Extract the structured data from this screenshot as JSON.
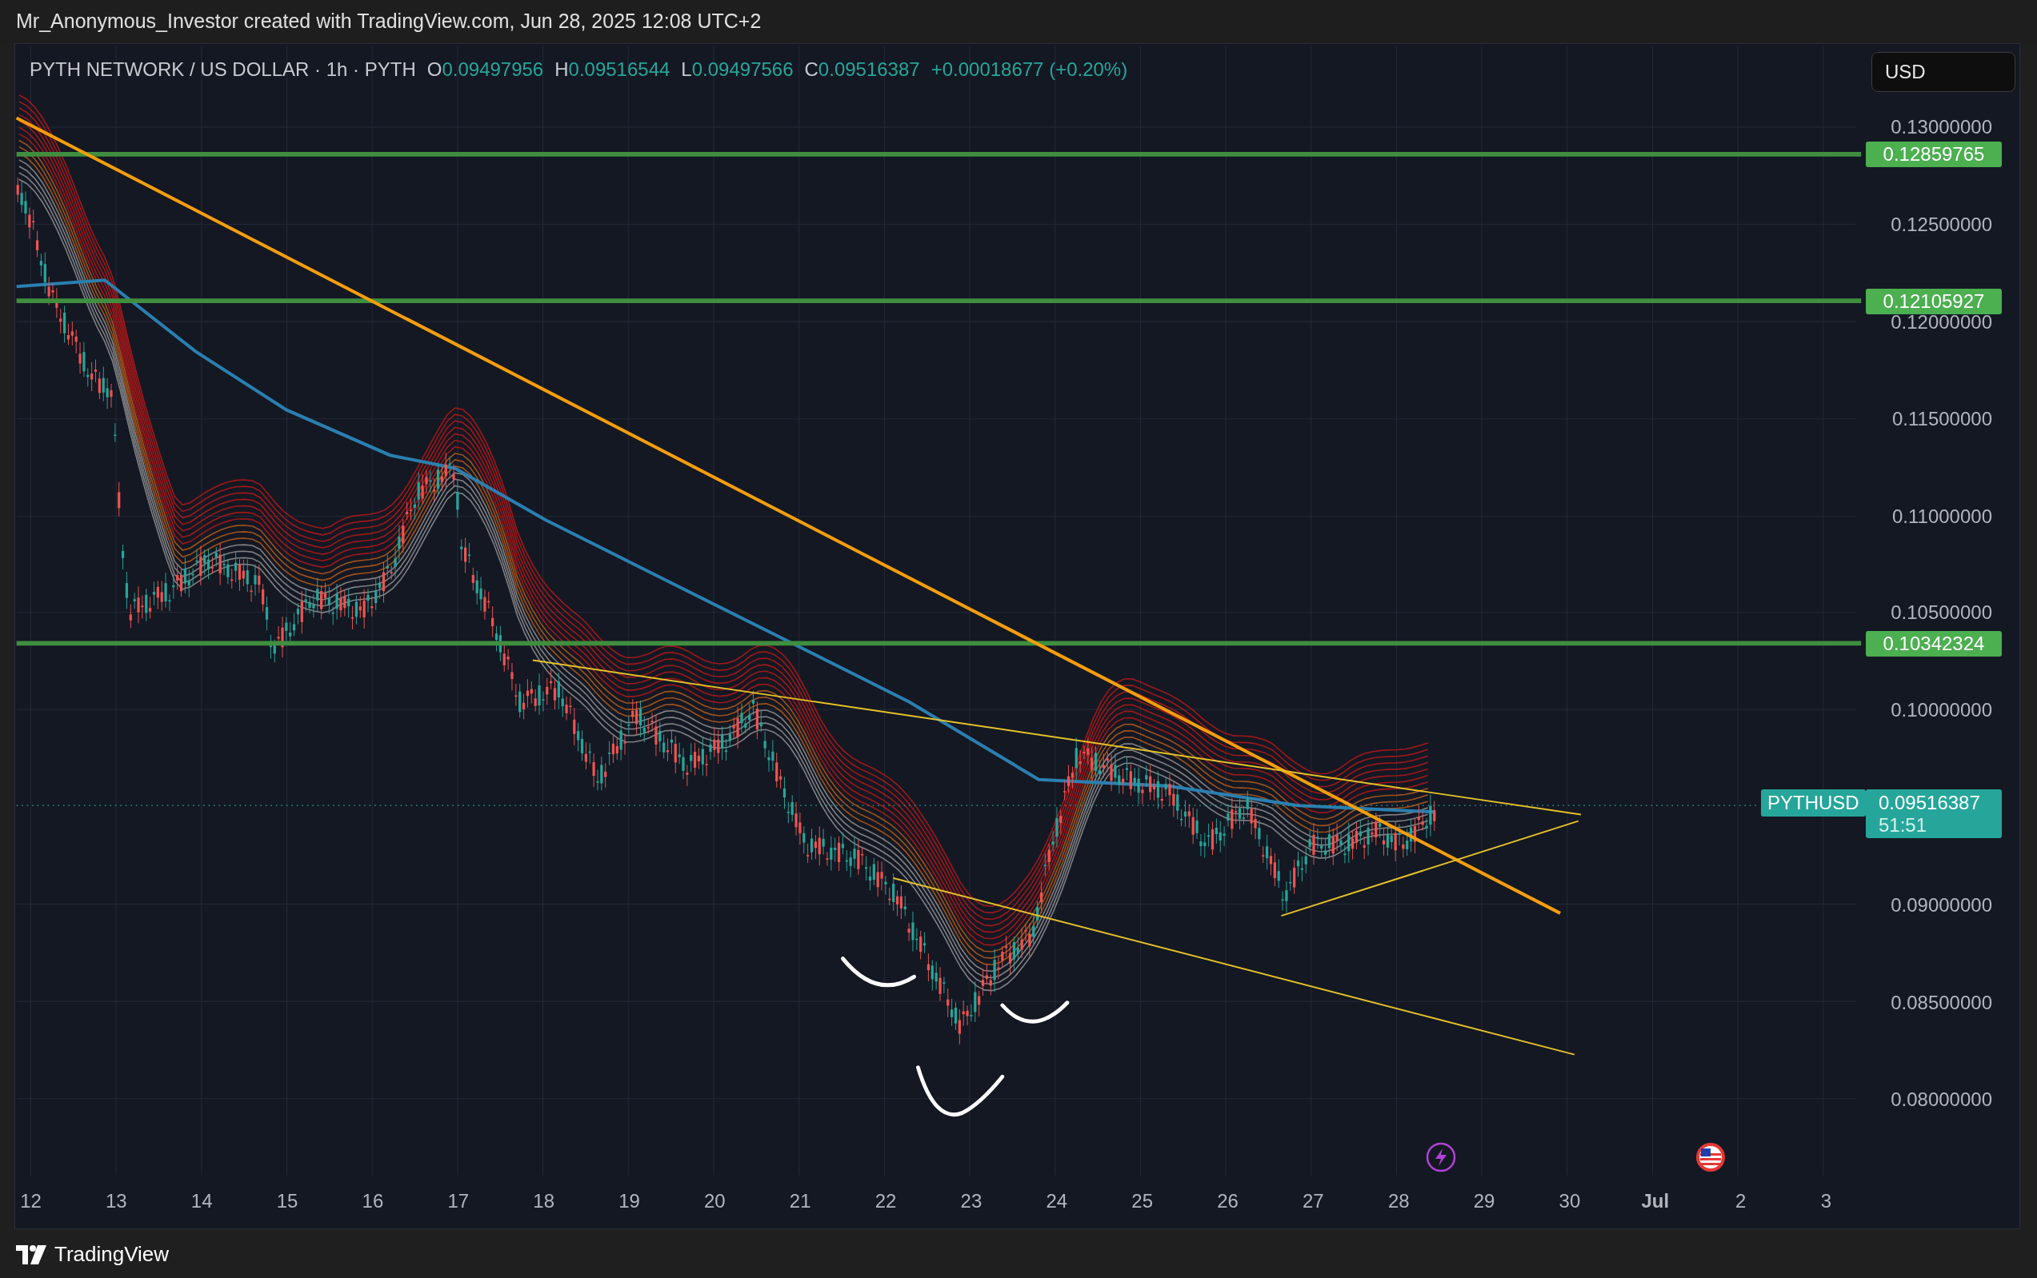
{
  "header": {
    "text": "Mr_Anonymous_Investor created with TradingView.com, Jun 28, 2025 12:08 UTC+2"
  },
  "legend": {
    "symbol": "PYTH NETWORK / US DOLLAR · 1h · PYTH",
    "values": [
      {
        "key": "O",
        "value": "0.09497956"
      },
      {
        "key": "H",
        "value": "0.09516544"
      },
      {
        "key": "L",
        "value": "0.09497566"
      },
      {
        "key": "C",
        "value": "0.09516387"
      }
    ],
    "change": "+0.00018677 (+0.20%)"
  },
  "currency_button": "USD",
  "price_axis": [
    "0.13000000",
    "0.12500000",
    "0.12000000",
    "0.11500000",
    "0.11000000",
    "0.10500000",
    "0.10000000",
    "0.09000000",
    "0.08500000",
    "0.08000000"
  ],
  "levels": [
    "0.12859765",
    "0.12105927",
    "0.10342324"
  ],
  "last_price": {
    "symbol": "PYTHUSD",
    "price": "0.09516387",
    "countdown": "51:51"
  },
  "time_axis": [
    {
      "label": "12",
      "kind": "day"
    },
    {
      "label": "13",
      "kind": "day"
    },
    {
      "label": "14",
      "kind": "day"
    },
    {
      "label": "15",
      "kind": "day"
    },
    {
      "label": "16",
      "kind": "day"
    },
    {
      "label": "17",
      "kind": "day"
    },
    {
      "label": "18",
      "kind": "day"
    },
    {
      "label": "19",
      "kind": "day"
    },
    {
      "label": "20",
      "kind": "day"
    },
    {
      "label": "21",
      "kind": "day"
    },
    {
      "label": "22",
      "kind": "day"
    },
    {
      "label": "23",
      "kind": "day"
    },
    {
      "label": "24",
      "kind": "day"
    },
    {
      "label": "25",
      "kind": "day"
    },
    {
      "label": "26",
      "kind": "day"
    },
    {
      "label": "27",
      "kind": "day"
    },
    {
      "label": "28",
      "kind": "day"
    },
    {
      "label": "29",
      "kind": "day"
    },
    {
      "label": "30",
      "kind": "day"
    },
    {
      "label": "Jul",
      "kind": "month"
    },
    {
      "label": "2",
      "kind": "day"
    },
    {
      "label": "3",
      "kind": "day"
    }
  ],
  "footer": {
    "brand": "TradingView"
  }
}
